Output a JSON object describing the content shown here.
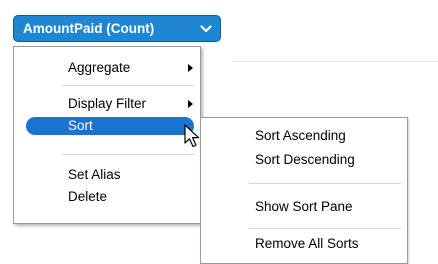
{
  "field_pill": {
    "label": "AmountPaid (Count)",
    "icon": "chevron-down-icon",
    "color": "#1f86d2"
  },
  "context_menu": {
    "items": [
      {
        "label": "Aggregate",
        "has_submenu": true
      },
      {
        "label": "Display Filter",
        "has_submenu": true
      },
      {
        "label": "Sort",
        "has_submenu": true,
        "active": true
      },
      {
        "label": "Set Alias",
        "has_submenu": false
      },
      {
        "label": "Delete",
        "has_submenu": false
      }
    ],
    "highlight_color": "#1b73d1"
  },
  "sort_submenu": {
    "items": [
      {
        "label": "Sort Ascending"
      },
      {
        "label": "Sort Descending"
      },
      {
        "label": "Show Sort Pane"
      },
      {
        "label": "Remove All Sorts"
      }
    ]
  }
}
